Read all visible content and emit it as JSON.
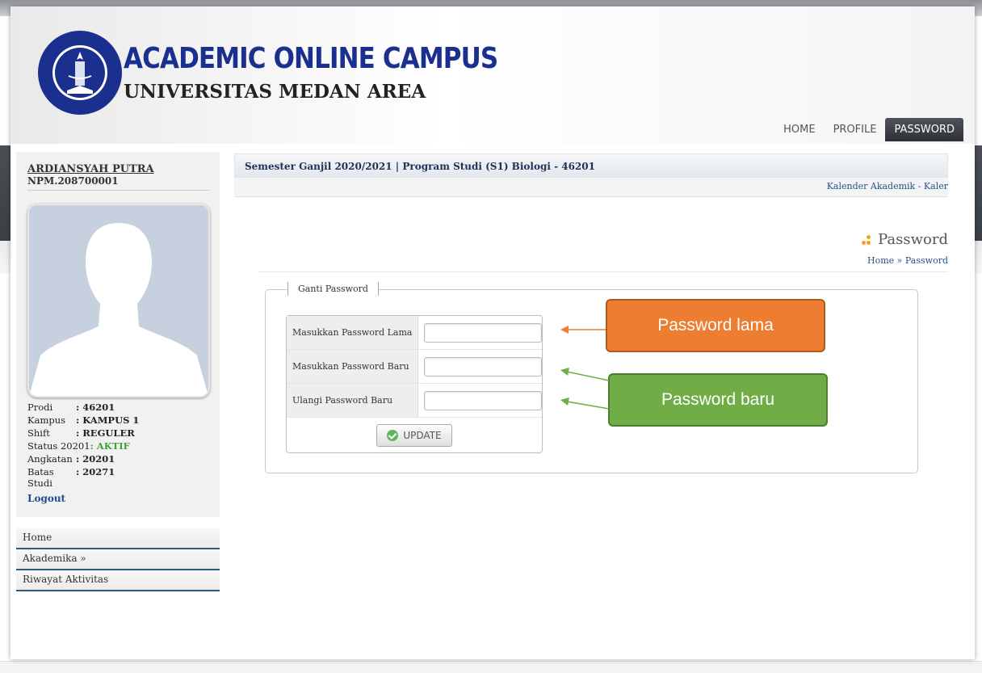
{
  "brand": {
    "title": "ACADEMIC ONLINE CAMPUS",
    "subtitle": "UNIVERSITAS MEDAN AREA",
    "logo_ring_top": "UNIVERSITAS",
    "logo_ring_bottom": "MEDAN AREA",
    "logo_center": "UMA"
  },
  "topnav": [
    {
      "label": "HOME",
      "active": false
    },
    {
      "label": "PROFILE",
      "active": false
    },
    {
      "label": "PASSWORD",
      "active": true
    }
  ],
  "user": {
    "name": "ARDIANSYAH PUTRA",
    "npm": "NPM.208700001",
    "info": [
      {
        "key": "Prodi",
        "value": ": 46201"
      },
      {
        "key": "Kampus",
        "value": ": KAMPUS 1"
      },
      {
        "key": "Shift",
        "value": ": REGULER"
      },
      {
        "key": "Status 20201",
        "value": ": AKTIF"
      },
      {
        "key": "Angkatan",
        "value": ": 20201"
      },
      {
        "key": "Batas Studi",
        "value": ": 20271"
      }
    ],
    "logout": "Logout"
  },
  "side_menu": [
    "Home",
    "Akademika »",
    "Riwayat Aktivitas"
  ],
  "semester_info": "Semester Ganjil 2020/2021 | Program Studi (S1) Biologi - 46201",
  "marquee": "Kalender Akademik - Kaler",
  "page": {
    "title": "Password",
    "breadcrumb": "Home » Password"
  },
  "form": {
    "legend": "Ganti Password",
    "fields": [
      {
        "label": "Masukkan Password Lama",
        "value": ""
      },
      {
        "label": "Masukkan Password Baru",
        "value": ""
      },
      {
        "label": "Ulangi Password Baru",
        "value": ""
      }
    ],
    "button": "UPDATE"
  },
  "annotations": {
    "old_password": "Password lama",
    "new_password": "Password baru"
  },
  "colors": {
    "brand_blue": "#1b2f8f",
    "nav_active": "#2d3136",
    "status_active": "#3aa23a",
    "callout_orange": "#ed7d31",
    "callout_green": "#70ad47"
  }
}
